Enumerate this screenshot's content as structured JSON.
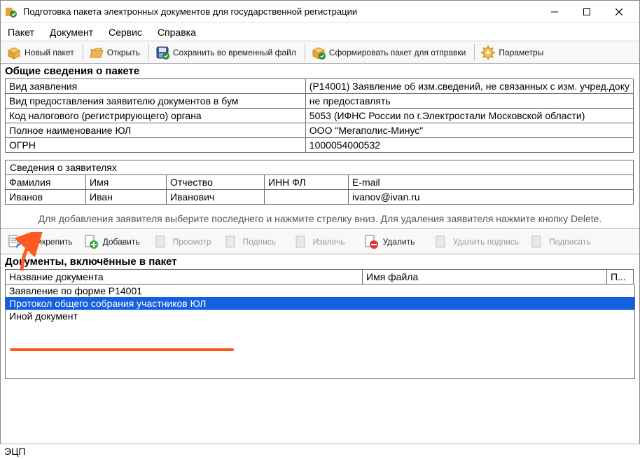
{
  "window": {
    "title": "Подготовка пакета электронных документов для государственной регистрации"
  },
  "menu": {
    "items": [
      "Пакет",
      "Документ",
      "Сервис",
      "Справка"
    ]
  },
  "toolbar": {
    "new_package": "Новый пакет",
    "open": "Открыть",
    "save_temp": "Сохранить во временный файл",
    "form_package": "Сформировать пакет для отправки",
    "parameters": "Параметры"
  },
  "general_heading": "Общие сведения о пакете",
  "info": {
    "rows": [
      {
        "label": "Вид заявления",
        "value": "(Р14001) Заявление об изм.сведений, не связанных с изм. учред.доку"
      },
      {
        "label": "Вид предоставления заявителю документов в бум",
        "value": "не предоставлять"
      },
      {
        "label": "Код налогового (регистрирующего) органа",
        "value": "5053 (ИФНС России по г.Электростали Московской области)"
      },
      {
        "label": "Полное наименование ЮЛ",
        "value": "ООО \"Мегаполис-Минус\""
      },
      {
        "label": "ОГРН",
        "value": "1000054000532"
      }
    ]
  },
  "applicants_heading": "Сведения о заявителях",
  "applicants": {
    "headers": [
      "Фамилия",
      "Имя",
      "Отчество",
      "ИНН ФЛ",
      "E-mail"
    ],
    "rows": [
      [
        "Иванов",
        "Иван",
        "Иванович",
        "",
        "ivanov@ivan.ru"
      ]
    ]
  },
  "hint": "Для добавления заявителя выберите последнего и нажмите стрелку вниз. Для удаления заявителя нажмите кнопку Delete.",
  "doc_toolbar": {
    "attach": "Прикрепить",
    "add": "Добавить",
    "view": "Просмотр",
    "signature": "Подпись",
    "extract": "Извлечь",
    "delete": "Удалить",
    "delete_sig": "Удалить подпись",
    "sign": "Подписать"
  },
  "docs_heading": "Документы, включённые в пакет",
  "docs": {
    "headers": [
      "Название документа",
      "Имя файла",
      "П..."
    ],
    "col_widths": [
      "510px",
      "340px",
      "38px"
    ],
    "rows": [
      {
        "name": "Заявление по форме Р14001",
        "file": "",
        "p": "",
        "selected": false
      },
      {
        "name": "Протокол общего собрания участников ЮЛ",
        "file": "",
        "p": "",
        "selected": true
      },
      {
        "name": "Иной документ",
        "file": "",
        "p": "",
        "selected": false
      }
    ]
  },
  "footer": {
    "ecp": "ЭЦП"
  }
}
